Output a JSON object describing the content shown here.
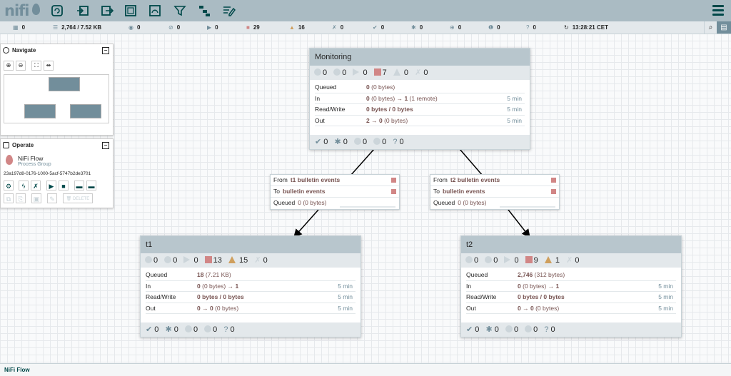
{
  "header": {
    "logo": "nifi",
    "tools": [
      "processor-icon",
      "input-port-icon",
      "output-port-icon",
      "process-group-icon",
      "remote-process-group-icon",
      "funnel-icon",
      "template-icon",
      "label-icon"
    ]
  },
  "status_bar": {
    "active_threads": "0",
    "queued": "2,764 / 7.52 KB",
    "transmitting": "0",
    "not_transmitting": "0",
    "running": "0",
    "stopped": "29",
    "invalid": "16",
    "disabled": "0",
    "up_to_date": "0",
    "locally_modified": "0",
    "stale": "0",
    "modified_stale": "0",
    "sync_failure": "0",
    "refresh_time": "13:28:21 CET"
  },
  "navigate": {
    "title": "Navigate"
  },
  "operate": {
    "title": "Operate",
    "name": "NiFi Flow",
    "type": "Process Group",
    "id": "23a197d8-0176-1000-5acf-5747b2de3701",
    "delete_label": "DELETE"
  },
  "groups": {
    "monitoring": {
      "title": "Monitoring",
      "stats": {
        "transmitting": "0",
        "not_transmitting": "0",
        "running": "0",
        "stopped": "7",
        "invalid": "0",
        "disabled": "0"
      },
      "queued_label": "Queued",
      "queued_count": "0",
      "queued_size": "(0 bytes)",
      "in_label": "In",
      "in_count": "0",
      "in_size": "(0 bytes)",
      "in_arrow": "→",
      "in_ports": "1",
      "in_ports_extra": "(1 remote)",
      "in_time": "5 min",
      "rw_label": "Read/Write",
      "rw_value": "0 bytes / 0 bytes",
      "rw_time": "5 min",
      "out_label": "Out",
      "out_ports": "2",
      "out_arrow": "→",
      "out_count": "0",
      "out_size": "(0 bytes)",
      "out_time": "5 min",
      "bottom": {
        "up_to_date": "0",
        "locally_modified": "0",
        "stale": "0",
        "modified_stale": "0",
        "sync_failure": "0"
      }
    },
    "t1": {
      "title": "t1",
      "stats": {
        "transmitting": "0",
        "not_transmitting": "0",
        "running": "0",
        "stopped": "13",
        "invalid": "15",
        "disabled": "0"
      },
      "queued_label": "Queued",
      "queued_count": "18",
      "queued_size": "(7.21 KB)",
      "in_label": "In",
      "in_count": "0",
      "in_size": "(0 bytes)",
      "in_arrow": "→",
      "in_ports": "1",
      "in_time": "5 min",
      "rw_label": "Read/Write",
      "rw_value": "0 bytes / 0 bytes",
      "rw_time": "5 min",
      "out_label": "Out",
      "out_ports": "0",
      "out_arrow": "→",
      "out_count": "0",
      "out_size": "(0 bytes)",
      "out_time": "5 min",
      "bottom": {
        "up_to_date": "0",
        "locally_modified": "0",
        "stale": "0",
        "modified_stale": "0",
        "sync_failure": "0"
      }
    },
    "t2": {
      "title": "t2",
      "stats": {
        "transmitting": "0",
        "not_transmitting": "0",
        "running": "0",
        "stopped": "9",
        "invalid": "1",
        "disabled": "0"
      },
      "queued_label": "Queued",
      "queued_count": "2,746",
      "queued_size": "(312 bytes)",
      "in_label": "In",
      "in_count": "0",
      "in_size": "(0 bytes)",
      "in_arrow": "→",
      "in_ports": "1",
      "in_time": "5 min",
      "rw_label": "Read/Write",
      "rw_value": "0 bytes / 0 bytes",
      "rw_time": "5 min",
      "out_label": "Out",
      "out_ports": "0",
      "out_arrow": "→",
      "out_count": "0",
      "out_size": "(0 bytes)",
      "out_time": "5 min",
      "bottom": {
        "up_to_date": "0",
        "locally_modified": "0",
        "stale": "0",
        "modified_stale": "0",
        "sync_failure": "0"
      }
    }
  },
  "connections": {
    "c1": {
      "from_label": "From",
      "from_name": "t1 bulletin events",
      "to_label": "To",
      "to_name": "bulletin events",
      "queued_label": "Queued",
      "queued_value": "0 (0 bytes)"
    },
    "c2": {
      "from_label": "From",
      "from_name": "t2 bulletin events",
      "to_label": "To",
      "to_name": "bulletin events",
      "queued_label": "Queued",
      "queued_value": "0 (0 bytes)"
    }
  },
  "footer": {
    "breadcrumb": "NiFi Flow"
  },
  "colors": {
    "accent": "#004849",
    "header": "#aabbc3",
    "stopped": "#d18686",
    "invalid": "#cf9f5d"
  }
}
